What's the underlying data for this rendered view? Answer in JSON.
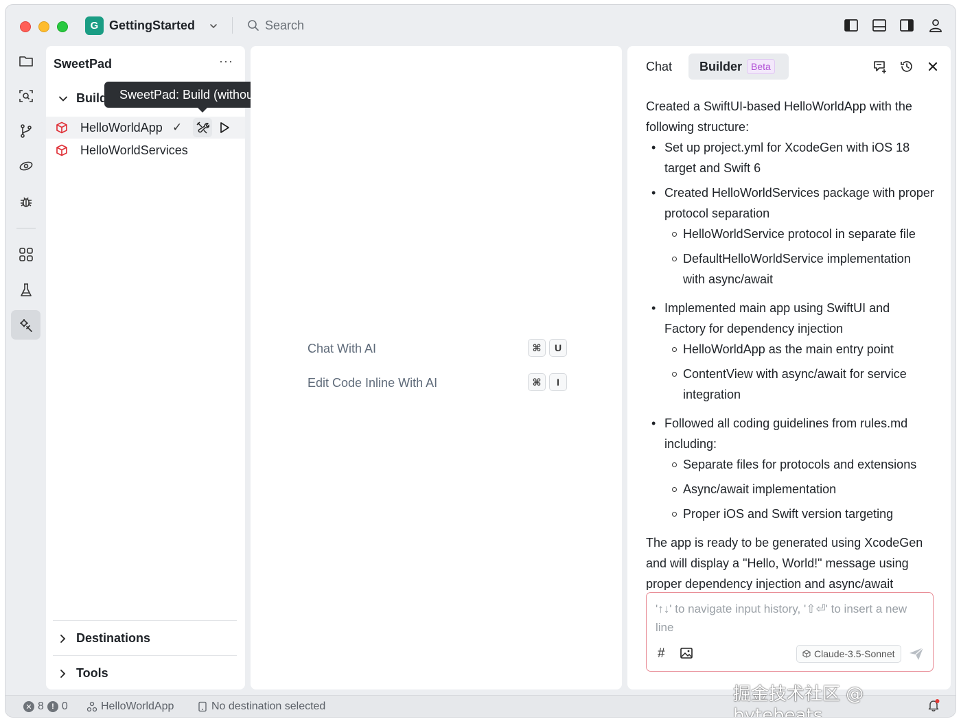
{
  "titlebar": {
    "project_badge": "G",
    "project_name": "GettingStarted",
    "search_placeholder": "Search"
  },
  "sidebar": {
    "title": "SweetPad",
    "more": "···",
    "build_label": "Build",
    "tooltip": "SweetPad: Build (without Run)",
    "items": [
      {
        "label": "HelloWorldApp",
        "status": "✓"
      },
      {
        "label": "HelloWorldServices"
      }
    ],
    "sections": [
      {
        "label": "Destinations"
      },
      {
        "label": "Tools"
      }
    ]
  },
  "center": {
    "shortcuts": [
      {
        "label": "Chat With AI",
        "keys": [
          "⌘",
          "U"
        ]
      },
      {
        "label": "Edit Code Inline With AI",
        "keys": [
          "⌘",
          "I"
        ]
      }
    ]
  },
  "chat": {
    "tabs": {
      "chat": "Chat",
      "builder": "Builder",
      "beta": "Beta"
    },
    "message": {
      "intro": "Created a SwiftUI-based HelloWorldApp with the following structure:",
      "bullets": [
        {
          "text": "Set up project.yml for XcodeGen with iOS 18 target and Swift 6",
          "sub": []
        },
        {
          "text": "Created HelloWorldServices package with proper protocol separation",
          "sub": [
            "HelloWorldService protocol in separate file",
            "DefaultHelloWorldService implementation with async/await"
          ]
        },
        {
          "text": "Implemented main app using SwiftUI and Factory for dependency injection",
          "sub": [
            "HelloWorldApp as the main entry point",
            "ContentView with async/await for service integration"
          ]
        },
        {
          "text": "Followed all coding guidelines from rules.md including:",
          "sub": [
            "Separate files for protocols and extensions",
            "Async/await implementation",
            "Proper iOS and Swift version targeting"
          ]
        }
      ],
      "outro": "The app is ready to be generated using XcodeGen and will display a \"Hello, World!\" message using proper dependency injection and async/await"
    },
    "input": {
      "placeholder": "'↑↓' to navigate input history, '⇧⏎' to insert a new line",
      "hash": "#",
      "model": "Claude-3.5-Sonnet"
    }
  },
  "statusbar": {
    "errors": "8",
    "warnings": "0",
    "scheme": "HelloWorldApp",
    "destination": "No destination selected"
  },
  "watermark": "掘金技术社区 @ bytebeats"
}
